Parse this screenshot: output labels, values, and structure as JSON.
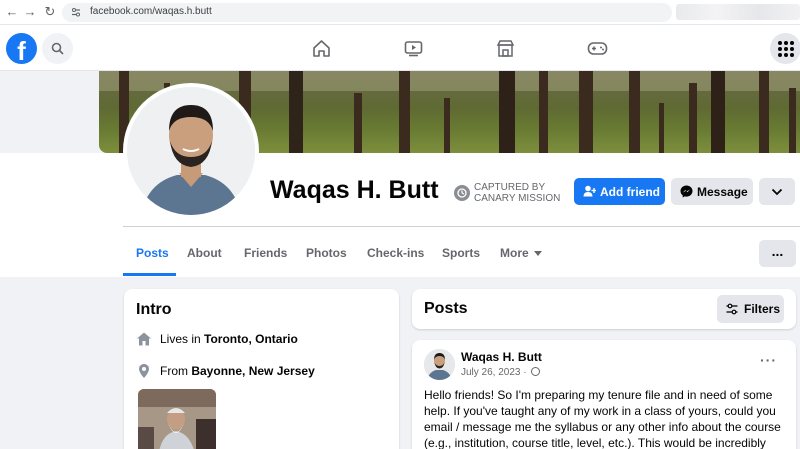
{
  "browser": {
    "url": "facebook.com/waqas.h.butt"
  },
  "nav": {
    "logo_letter": "f",
    "icons": [
      "home-icon",
      "watch-icon",
      "marketplace-icon",
      "gaming-icon",
      "menu-grid-icon"
    ]
  },
  "profile": {
    "name": "Waqas H. Butt",
    "captured_line1": "CAPTURED BY",
    "captured_line2": "CANARY MISSION",
    "add_friend_label": "Add friend",
    "message_label": "Message"
  },
  "tabs": [
    {
      "label": "Posts",
      "active": true
    },
    {
      "label": "About"
    },
    {
      "label": "Friends"
    },
    {
      "label": "Photos"
    },
    {
      "label": "Check-ins"
    },
    {
      "label": "Sports"
    },
    {
      "label": "More"
    }
  ],
  "tabs_more_button": "...",
  "intro": {
    "title": "Intro",
    "lives_prefix": "Lives in ",
    "lives_place": "Toronto, Ontario",
    "from_prefix": "From ",
    "from_place": "Bayonne, New Jersey"
  },
  "posts_header": {
    "title": "Posts",
    "filters_label": "Filters"
  },
  "post": {
    "author": "Waqas H. Butt",
    "date": "July 26, 2023 ·",
    "menu": "···",
    "body": "Hello friends! So I'm preparing my tenure file and in need of some help. If you've taught any of my work in a class of yours, could you email / message me the syllabus or any other info about the course (e.g., institution, course title, level, etc.). This would be incredibly"
  },
  "colors": {
    "fb_blue": "#1877f2",
    "page_bg": "#f0f2f5",
    "secondary_text": "#65676b"
  }
}
